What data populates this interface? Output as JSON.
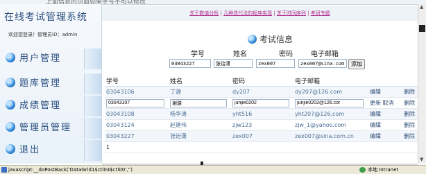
{
  "top_strip_text": "上面信息的页面如果学号不可以修改",
  "sidebar": {
    "brand": "在线考试管理系统",
    "welcome": "欢迎您登录！管理员ID：admin",
    "items": [
      {
        "label": "用户管理"
      },
      {
        "label": "题库管理"
      },
      {
        "label": "成绩管理"
      },
      {
        "label": "管理员管理"
      },
      {
        "label": "退出"
      }
    ]
  },
  "topnav": {
    "links": [
      "关于数值分析",
      "几种迭代法的程序实现",
      "关于时间序列",
      "考研专题"
    ]
  },
  "page_title": "考试信息",
  "form": {
    "labels": {
      "id": "学号",
      "name": "姓名",
      "password": "密码",
      "email": "电子邮箱"
    },
    "values": {
      "id": "03043227",
      "name": "张诒潇",
      "password": "zex007",
      "email": "zex007@sina.com.c"
    },
    "add_label": "添加"
  },
  "table": {
    "headers": [
      "学号",
      "姓名",
      "密码",
      "电子邮箱"
    ],
    "rows": [
      {
        "id": "03043106",
        "name": "丁源",
        "password": "dy207",
        "email": "dy207@126.com",
        "act1": "编辑",
        "act2": "删除"
      },
      {
        "id": "03043107",
        "name": "谢骏",
        "password": "junjie0202",
        "email": "junjie0202@126.cor",
        "act1": "更新 取消",
        "act2": "删除",
        "editing": true
      },
      {
        "id": "03043108",
        "name": "杨华涛",
        "password": "yht516",
        "email": "yht207@126.com",
        "act1": "编辑",
        "act2": "删除"
      },
      {
        "id": "03043124",
        "name": "赵建伟",
        "password": "zjw123",
        "email": "zjw_1@yahoo.com",
        "act1": "编辑",
        "act2": "删除"
      },
      {
        "id": "03043227",
        "name": "张诒潇",
        "password": "zex007",
        "email": "zex007@sina.com.cn",
        "act1": "编辑",
        "act2": "删除"
      }
    ],
    "pager": "1"
  },
  "statusbar": {
    "text": "javascript:__doPostBack('DataGrid1$ctl04$ctl00','')",
    "zone": "本地 Intranet"
  },
  "colors": {
    "accent": "#2a4f7e",
    "link": "#b02a8a",
    "cell_text": "#4a6f96"
  }
}
